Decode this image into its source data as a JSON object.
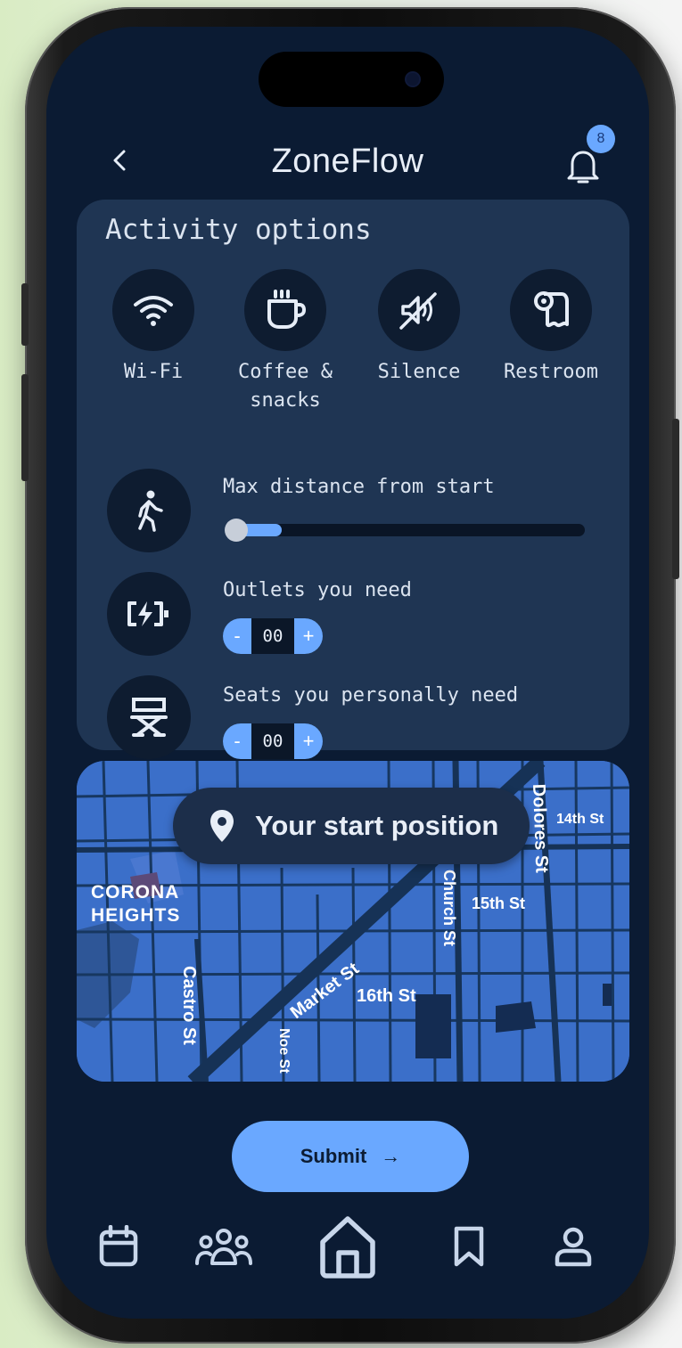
{
  "app": {
    "title": "ZoneFlow",
    "notification_count": "8",
    "back_icon": "chevron-left-icon",
    "bell_icon": "bell-icon"
  },
  "colors": {
    "screen_bg": "#0b1b33",
    "card_bg": "#1f3553",
    "accent": "#6aa8ff",
    "map_bg": "#3b6fc9"
  },
  "activity_options": {
    "title": "Activity options",
    "amenities": [
      {
        "label_line1": "Wi-Fi",
        "label_line2": "",
        "icon": "wifi-icon"
      },
      {
        "label_line1": "Coffee &",
        "label_line2": "snacks",
        "icon": "coffee-icon"
      },
      {
        "label_line1": "Silence",
        "label_line2": "",
        "icon": "silence-icon"
      },
      {
        "label_line1": "Restroom",
        "label_line2": "",
        "icon": "toilet-paper-icon"
      }
    ],
    "distance": {
      "label": "Max distance from start",
      "icon": "walking-icon",
      "value_fraction": 0.15
    },
    "outlets": {
      "label": "Outlets you need",
      "icon": "charging-icon",
      "value": "00",
      "decrement": "-",
      "increment": "+"
    },
    "seats": {
      "label": "Seats you personally need",
      "icon": "director-chair-icon",
      "value": "00",
      "decrement": "-",
      "increment": "+"
    }
  },
  "map": {
    "pill_label": "Your start position",
    "pin_icon": "location-pin-icon",
    "labels": {
      "corona": "CORONA",
      "heights": "HEIGHTS",
      "market": "Market St",
      "church": "Church St",
      "dolores": "Dolores St",
      "castro": "Castro St",
      "noe": "Noe St",
      "st14": "14th St",
      "st15": "15th St",
      "st16": "16th St"
    }
  },
  "submit": {
    "label": "Submit",
    "arrow": "→"
  },
  "nav": [
    {
      "icon": "calendar-icon"
    },
    {
      "icon": "group-icon"
    },
    {
      "icon": "home-icon"
    },
    {
      "icon": "bookmark-icon"
    },
    {
      "icon": "profile-icon"
    }
  ]
}
